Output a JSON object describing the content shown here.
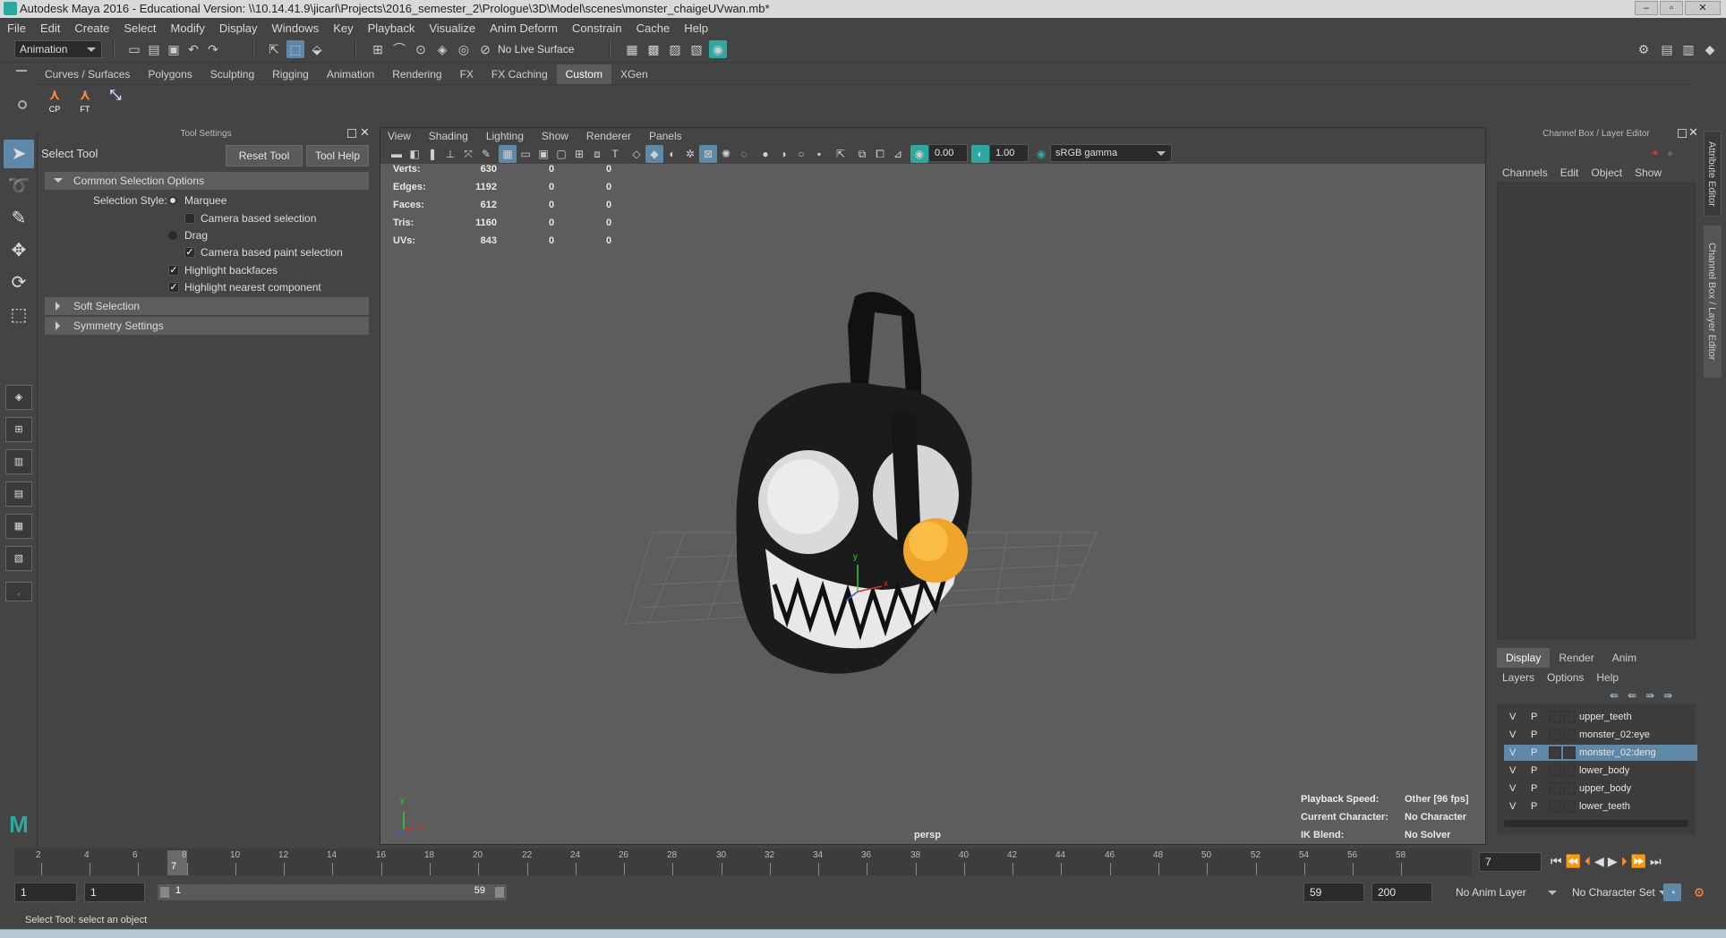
{
  "window": {
    "title": "Autodesk Maya 2016 - Educational Version: \\\\10.14.41.9\\jicarl\\Projects\\2016_semester_2\\Prologue\\3D\\Model\\scenes\\monster_chaigeUVwan.mb*",
    "buttons": [
      "–",
      "▫",
      "✕"
    ]
  },
  "menubar": [
    "File",
    "Edit",
    "Create",
    "Select",
    "Modify",
    "Display",
    "Windows",
    "Key",
    "Playback",
    "Visualize",
    "Anim Deform",
    "Constrain",
    "Cache",
    "Help"
  ],
  "statusline": {
    "menuset": "Animation",
    "live_surface": "No Live Surface"
  },
  "shelf": {
    "tabs": [
      "Curves / Surfaces",
      "Polygons",
      "Sculpting",
      "Rigging",
      "Animation",
      "Rendering",
      "FX",
      "FX Caching",
      "Custom",
      "XGen"
    ],
    "active_tab": "Custom",
    "buttons": [
      {
        "label": "CP",
        "icon": "joint-icon"
      },
      {
        "label": "FT",
        "icon": "joint-icon"
      },
      {
        "label": "",
        "icon": "pick-icon"
      }
    ]
  },
  "tool_settings": {
    "panel_title": "Tool Settings",
    "tool_name": "Select Tool",
    "reset_label": "Reset Tool",
    "help_label": "Tool Help",
    "common_header": "Common Selection Options",
    "selection_style_label": "Selection Style:",
    "marquee_label": "Marquee",
    "camera_based_label": "Camera based selection",
    "drag_label": "Drag",
    "camera_paint_label": "Camera based paint selection",
    "highlight_backfaces_label": "Highlight backfaces",
    "highlight_nearest_label": "Highlight nearest component",
    "soft_header": "Soft Selection",
    "symmetry_header": "Symmetry Settings"
  },
  "viewport": {
    "menu": [
      "View",
      "Shading",
      "Lighting",
      "Show",
      "Renderer",
      "Panels"
    ],
    "exposure": "0.00",
    "gamma": "1.00",
    "colorspace": "sRGB gamma",
    "stats": [
      {
        "label": "Verts:",
        "a": "630",
        "b": "0",
        "c": "0"
      },
      {
        "label": "Edges:",
        "a": "1192",
        "b": "0",
        "c": "0"
      },
      {
        "label": "Faces:",
        "a": "612",
        "b": "0",
        "c": "0"
      },
      {
        "label": "Tris:",
        "a": "1160",
        "b": "0",
        "c": "0"
      },
      {
        "label": "UVs:",
        "a": "843",
        "b": "0",
        "c": "0"
      }
    ],
    "camera": "persp",
    "axis": {
      "x": "x",
      "y": "y"
    },
    "hud": {
      "playback_label": "Playback Speed:",
      "playback_value": "Other  [96 fps]",
      "character_label": "Current Character:",
      "character_value": "No Character",
      "ik_label": "IK Blend:",
      "ik_value": "No Solver"
    }
  },
  "channel_box": {
    "title": "Channel Box / Layer Editor",
    "menu": [
      "Channels",
      "Edit",
      "Object",
      "Show"
    ],
    "layer_tabs": [
      "Display",
      "Render",
      "Anim"
    ],
    "active_layer_tab": "Display",
    "layer_menu": [
      "Layers",
      "Options",
      "Help"
    ],
    "layers": [
      {
        "v": "V",
        "p": "P",
        "name": "upper_teeth"
      },
      {
        "v": "V",
        "p": "P",
        "name": "monster_02:eye"
      },
      {
        "v": "V",
        "p": "P",
        "name": "monster_02:deng"
      },
      {
        "v": "V",
        "p": "P",
        "name": "lower_body"
      },
      {
        "v": "V",
        "p": "P",
        "name": "upper_body"
      },
      {
        "v": "V",
        "p": "P",
        "name": "lower_teeth"
      }
    ],
    "selected_layer": "monster_02:deng"
  },
  "side_tabs": [
    "Attribute Editor",
    "Channel Box / Layer Editor"
  ],
  "time_slider": {
    "ticks": [
      "2",
      "4",
      "6",
      "8",
      "10",
      "12",
      "14",
      "16",
      "18",
      "20",
      "22",
      "24",
      "26",
      "28",
      "30",
      "32",
      "34",
      "36",
      "38",
      "40",
      "42",
      "44",
      "46",
      "48",
      "50",
      "52",
      "54",
      "56",
      "58"
    ],
    "current_frame": "7",
    "current_frame_field": "7"
  },
  "range_slider": {
    "start": "1",
    "start2": "1",
    "range_start": "1",
    "range_end": "59",
    "end": "59",
    "end2": "200",
    "anim_layer": "No Anim Layer",
    "character_set": "No Character Set"
  },
  "help_line": "Select Tool: select an object",
  "colors": {
    "accent": "#5d88a8",
    "background": "#444444",
    "viewport": "#5d5d5d"
  }
}
